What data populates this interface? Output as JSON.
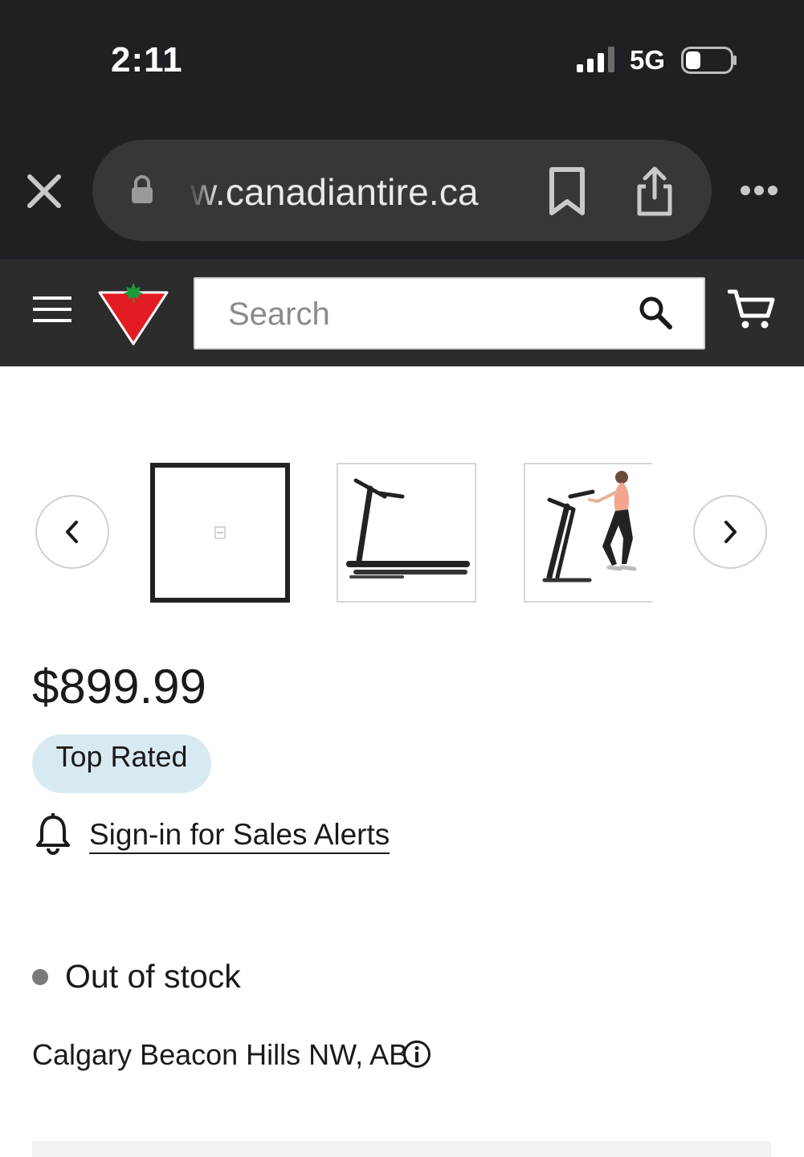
{
  "status_bar": {
    "time": "2:11",
    "network": "5G",
    "signal_icon": "cellular-signal-icon",
    "battery_icon": "battery-icon"
  },
  "browser": {
    "url": "w.canadiantire.ca",
    "icons": {
      "close": "close-icon",
      "lock": "lock-icon",
      "bookmark": "bookmark-icon",
      "share": "share-icon",
      "more": "more-options-icon"
    }
  },
  "header": {
    "search_placeholder": "Search",
    "icons": {
      "menu": "hamburger-menu-icon",
      "logo": "canadian-tire-logo",
      "search": "search-icon",
      "cart": "cart-icon"
    },
    "colors": {
      "logo_red": "#e31b23",
      "logo_leaf": "#1a9b3c",
      "header_bg": "#2c2c2c"
    }
  },
  "carousel": {
    "thumbnails": [
      {
        "alt": "Product image placeholder",
        "selected": true
      },
      {
        "alt": "Treadmill side view",
        "selected": false
      },
      {
        "alt": "Person using treadmill",
        "selected": false
      }
    ],
    "icons": {
      "prev": "chevron-left-icon",
      "next": "chevron-right-icon"
    }
  },
  "product": {
    "price": "$899.99",
    "badge": "Top Rated",
    "alerts_link": "Sign-in for Sales Alerts",
    "stock_status": "Out of stock",
    "store": "Calgary Beacon Hills NW, AB",
    "colors": {
      "badge_bg": "#d9e9f1",
      "stock_dot": "#7a7a7a"
    }
  }
}
